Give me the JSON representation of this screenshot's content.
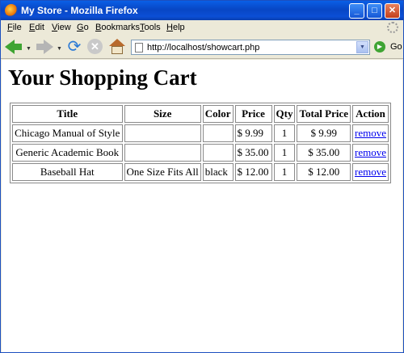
{
  "window": {
    "title": "My Store - Mozilla Firefox"
  },
  "menu": [
    "File",
    "Edit",
    "View",
    "Go",
    "Bookmarks",
    "Tools",
    "Help"
  ],
  "menu_underline": [
    "F",
    "E",
    "V",
    "G",
    "B",
    "T",
    "H"
  ],
  "nav": {
    "url": "http://localhost/showcart.php",
    "go_label": "Go"
  },
  "page": {
    "heading": "Your Shopping Cart",
    "columns": [
      "Title",
      "Size",
      "Color",
      "Price",
      "Qty",
      "Total Price",
      "Action"
    ],
    "rows": [
      {
        "title": "Chicago Manual of Style",
        "size": "",
        "color": "",
        "price": "$ 9.99",
        "qty": "1",
        "total": "$ 9.99",
        "action": "remove"
      },
      {
        "title": "Generic Academic Book",
        "size": "",
        "color": "",
        "price": "$ 35.00",
        "qty": "1",
        "total": "$ 35.00",
        "action": "remove"
      },
      {
        "title": "Baseball Hat",
        "size": "One Size Fits All",
        "color": "black",
        "price": "$ 12.00",
        "qty": "1",
        "total": "$ 12.00",
        "action": "remove"
      }
    ]
  },
  "icons": {
    "app": "firefox-icon",
    "back": "back-arrow-icon",
    "forward": "forward-arrow-icon",
    "reload": "reload-icon",
    "stop": "stop-icon",
    "home": "home-icon",
    "go": "go-icon"
  }
}
